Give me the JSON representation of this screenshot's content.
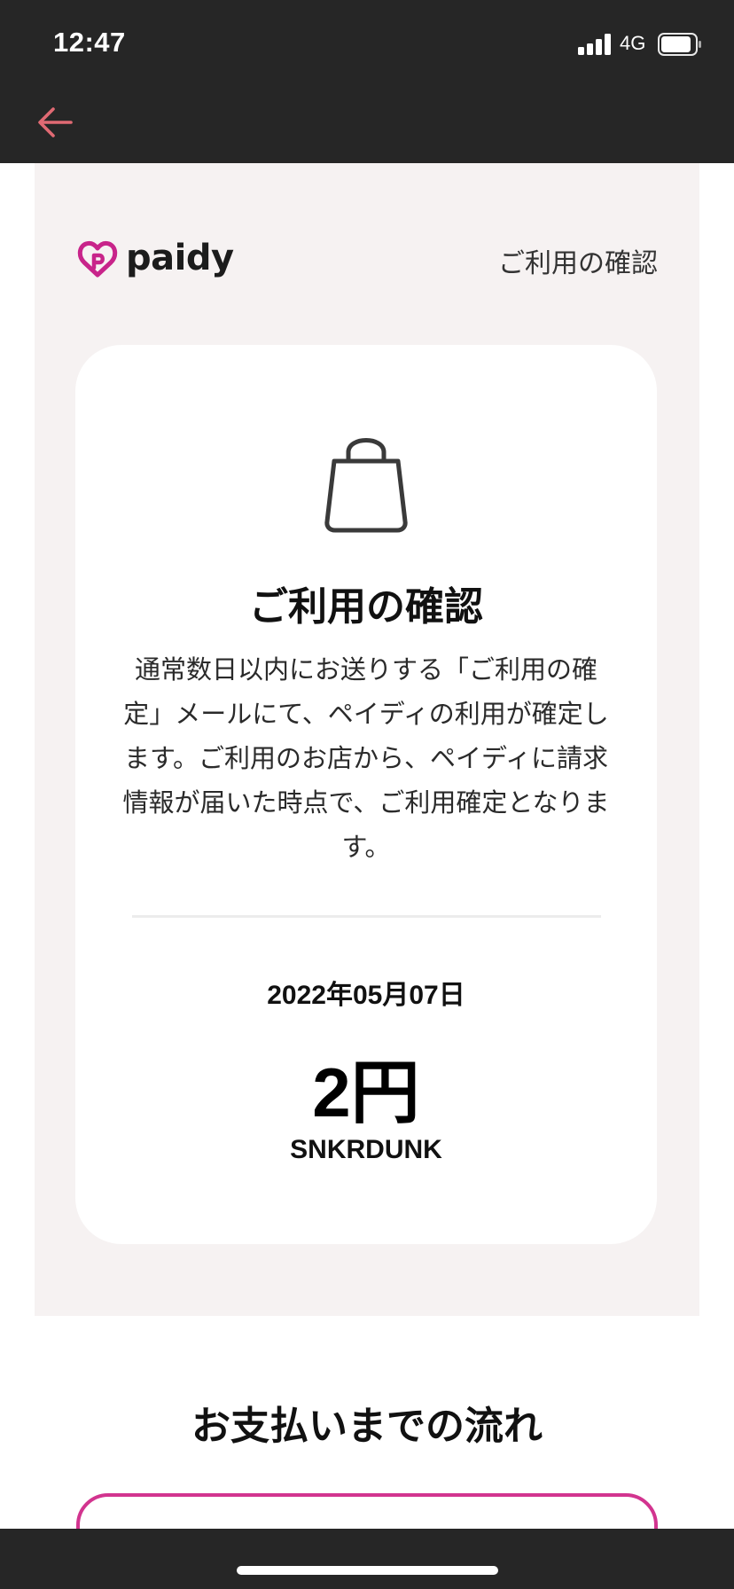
{
  "status_bar": {
    "time": "12:47",
    "network": "4G"
  },
  "nav": {
    "back_icon": "arrow-left-icon",
    "back_color": "#e06a73"
  },
  "brand": {
    "logo_icon": "paidy-logo-icon",
    "name": "paidy",
    "color": "#c8248a"
  },
  "header": {
    "title": "ご利用の確認"
  },
  "card": {
    "icon": "shopping-bag-icon",
    "title": "ご利用の確認",
    "description": "通常数日以内にお送りする「ご利用の確定」メールにて、ペイディの利用が確定します。ご利用のお店から、ペイディに請求情報が届いた時点で、ご利用確定となります。",
    "date": "2022年05月07日",
    "amount": "2円",
    "merchant": "SNKRDUNK"
  },
  "flow": {
    "title": "お支払いまでの流れ",
    "accent": "#d2348f"
  }
}
